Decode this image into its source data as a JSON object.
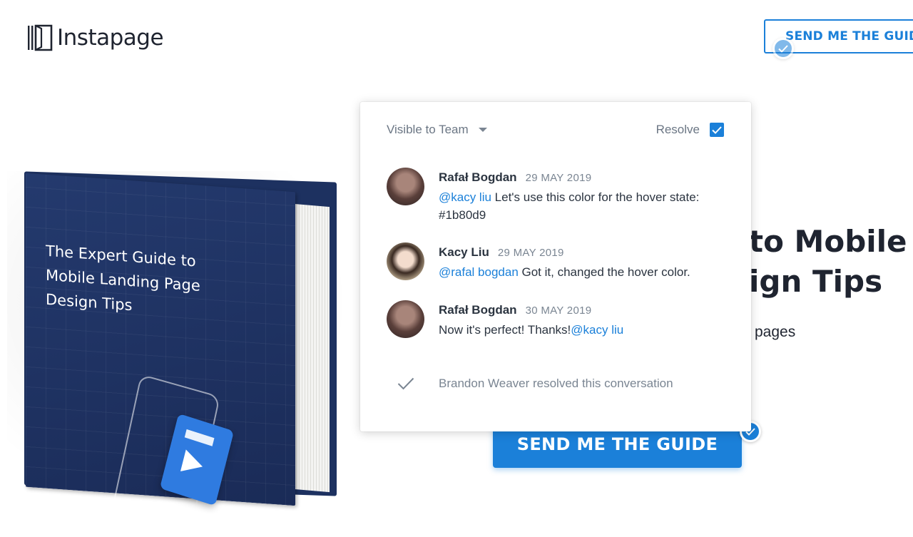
{
  "brand": {
    "name": "Instapage"
  },
  "header": {
    "cta_label": "SEND ME THE GUIDE"
  },
  "hero": {
    "heading_line1": "to Mobile",
    "heading_line2": "ign Tips",
    "subtext": "pages",
    "cta_label": "SEND ME THE GUIDE"
  },
  "book": {
    "title_lines": [
      "The Expert Guide to",
      "Mobile Landing Page",
      "Design Tips"
    ]
  },
  "popup": {
    "visibility_label": "Visible to Team",
    "resolve_label": "Resolve",
    "resolve_checked": true,
    "comments": [
      {
        "author": "Rafał Bogdan",
        "date": "29 MAY 2019",
        "mention": "@kacy liu",
        "text": " Let's use this color for the hover state: #1b80d9"
      },
      {
        "author": "Kacy Liu",
        "date": "29 MAY 2019",
        "mention": "@rafal bogdan",
        "text": " Got it, changed the hover color."
      },
      {
        "author": "Rafał Bogdan",
        "date": "30 MAY 2019",
        "text": "Now it's perfect! Thanks!",
        "mention": "@kacy liu"
      }
    ],
    "resolved_text": "Brandon Weaver resolved this conversation"
  },
  "colors": {
    "accent": "#1b80d9",
    "text": "#2b3440",
    "muted": "#7a8592"
  }
}
